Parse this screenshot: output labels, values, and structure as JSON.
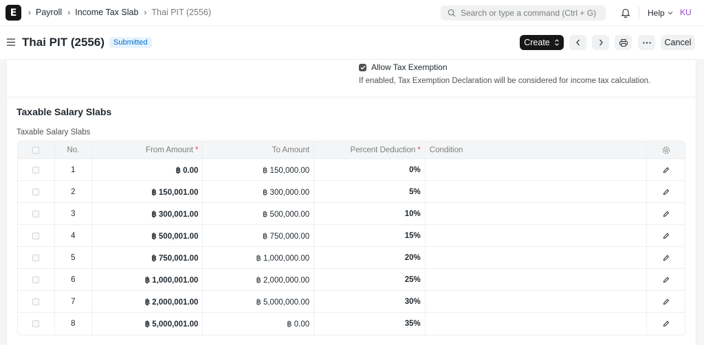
{
  "navbar": {
    "logo_letter": "E",
    "breadcrumbs": [
      "Payroll",
      "Income Tax Slab",
      "Thai PIT (2556)"
    ],
    "search_placeholder": "Search or type a command (Ctrl + G)",
    "help_label": "Help",
    "avatar_initials": "KU"
  },
  "page": {
    "title": "Thai PIT (2556)",
    "status": "Submitted",
    "create_label": "Create",
    "cancel_label": "Cancel"
  },
  "form": {
    "allow_exemption_label": "Allow Tax Exemption",
    "allow_exemption_checked": true,
    "exemption_description": "If enabled, Tax Exemption Declaration will be considered for income tax calculation.",
    "section_title": "Taxable Salary Slabs",
    "table_label": "Taxable Salary Slabs"
  },
  "table": {
    "columns": {
      "no": "No.",
      "from": "From Amount",
      "to": "To Amount",
      "pct": "Percent Deduction",
      "cond": "Condition"
    },
    "rows": [
      {
        "no": "1",
        "from": "฿ 0.00",
        "to": "฿ 150,000.00",
        "pct": "0%",
        "cond": ""
      },
      {
        "no": "2",
        "from": "฿ 150,001.00",
        "to": "฿ 300,000.00",
        "pct": "5%",
        "cond": ""
      },
      {
        "no": "3",
        "from": "฿ 300,001.00",
        "to": "฿ 500,000.00",
        "pct": "10%",
        "cond": ""
      },
      {
        "no": "4",
        "from": "฿ 500,001.00",
        "to": "฿ 750,000.00",
        "pct": "15%",
        "cond": ""
      },
      {
        "no": "5",
        "from": "฿ 750,001.00",
        "to": "฿ 1,000,000.00",
        "pct": "20%",
        "cond": ""
      },
      {
        "no": "6",
        "from": "฿ 1,000,001.00",
        "to": "฿ 2,000,000.00",
        "pct": "25%",
        "cond": ""
      },
      {
        "no": "7",
        "from": "฿ 2,000,001.00",
        "to": "฿ 5,000,000.00",
        "pct": "30%",
        "cond": ""
      },
      {
        "no": "8",
        "from": "฿ 5,000,001.00",
        "to": "฿ 0.00",
        "pct": "35%",
        "cond": ""
      }
    ]
  },
  "icons": {
    "search": "search-icon",
    "bell": "bell-icon",
    "menu": "hamburger-icon",
    "prev": "chevron-left-icon",
    "next": "chevron-right-icon",
    "print": "printer-icon",
    "more": "more-icon",
    "settings": "gear-icon",
    "edit": "pencil-icon"
  }
}
